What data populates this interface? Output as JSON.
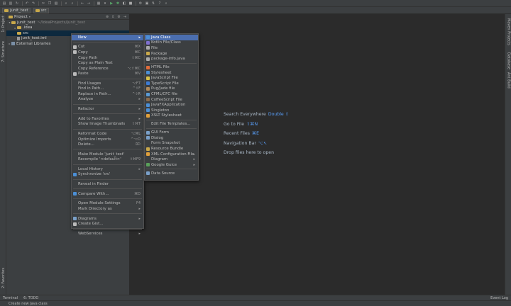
{
  "breadcrumb": [
    "junit_test",
    "src"
  ],
  "project_panel": {
    "title": "Project",
    "icons": [
      "⊕",
      "⇕",
      "⚙",
      "⇥"
    ],
    "tree": [
      {
        "label": "junit_test",
        "path": "~/IdeaProjects/junit_test",
        "depth": 0,
        "arrow": "▾",
        "icon": "folder"
      },
      {
        "label": ".idea",
        "path": "",
        "depth": 1,
        "arrow": "▸",
        "icon": "folder"
      },
      {
        "label": "src",
        "path": "",
        "depth": 1,
        "arrow": "",
        "icon": "folder",
        "selected": true
      },
      {
        "label": "junit_test.iml",
        "path": "",
        "depth": 1,
        "arrow": "",
        "icon": "file"
      },
      {
        "label": "External Libraries",
        "path": "",
        "depth": 0,
        "arrow": "▸",
        "icon": "lib"
      }
    ]
  },
  "left_tabs": [
    "1: Project",
    "7: Structure",
    "2: Favorites"
  ],
  "right_tabs": [
    "Maven Projects",
    "Database",
    "Ant Build"
  ],
  "editor_hints": [
    {
      "text": "Search Everywhere",
      "shortcut": "Double ⇧"
    },
    {
      "text": "Go to File",
      "shortcut": "⇧⌘N"
    },
    {
      "text": "Recent Files",
      "shortcut": "⌘E"
    },
    {
      "text": "Navigation Bar",
      "shortcut": "⌥↖"
    },
    {
      "text": "Drop files here to open",
      "shortcut": ""
    }
  ],
  "context_menu": [
    {
      "label": "New",
      "shortcut": "",
      "submenu": true,
      "highlight": true
    },
    {
      "sep": true
    },
    {
      "label": "Cut",
      "shortcut": "⌘X",
      "icon": "cut"
    },
    {
      "label": "Copy",
      "shortcut": "⌘C",
      "icon": "copy"
    },
    {
      "label": "Copy Path",
      "shortcut": "⇧⌘C"
    },
    {
      "label": "Copy as Plain Text",
      "shortcut": ""
    },
    {
      "label": "Copy Reference",
      "shortcut": "⌥⇧⌘C"
    },
    {
      "label": "Paste",
      "shortcut": "⌘V",
      "icon": "paste"
    },
    {
      "sep": true
    },
    {
      "label": "Find Usages",
      "shortcut": "⌥F7"
    },
    {
      "label": "Find in Path...",
      "shortcut": "^⇧F"
    },
    {
      "label": "Replace in Path...",
      "shortcut": "^⇧R"
    },
    {
      "label": "Analyze",
      "shortcut": "",
      "submenu": true
    },
    {
      "sep": true
    },
    {
      "label": "Refactor",
      "shortcut": "",
      "submenu": true
    },
    {
      "sep": true
    },
    {
      "label": "Add to Favorites",
      "shortcut": "",
      "submenu": true
    },
    {
      "label": "Show Image Thumbnails",
      "shortcut": "⇧⌘T"
    },
    {
      "sep": true
    },
    {
      "label": "Reformat Code",
      "shortcut": "⌥⌘L"
    },
    {
      "label": "Optimize Imports",
      "shortcut": "^⌥O"
    },
    {
      "label": "Delete...",
      "shortcut": "⌦"
    },
    {
      "sep": true
    },
    {
      "label": "Make Module 'junit_test'",
      "shortcut": ""
    },
    {
      "label": "Recompile '<default>'",
      "shortcut": "⇧⌘F9"
    },
    {
      "sep": true
    },
    {
      "label": "Local History",
      "shortcut": "",
      "submenu": true
    },
    {
      "label": "Synchronize 'src'",
      "shortcut": "",
      "icon": "sync"
    },
    {
      "sep": true
    },
    {
      "label": "Reveal in Finder",
      "shortcut": ""
    },
    {
      "sep": true
    },
    {
      "label": "Compare With...",
      "shortcut": "⌘D",
      "icon": "compare"
    },
    {
      "sep": true
    },
    {
      "label": "Open Module Settings",
      "shortcut": "F4"
    },
    {
      "label": "Mark Directory as",
      "shortcut": "",
      "submenu": true
    },
    {
      "sep": true
    },
    {
      "label": "Diagrams",
      "shortcut": "",
      "submenu": true,
      "icon": "diagram"
    },
    {
      "label": "Create Gist...",
      "shortcut": "",
      "icon": "gist"
    },
    {
      "sep": true
    },
    {
      "label": "WebServices",
      "shortcut": "",
      "submenu": true
    }
  ],
  "new_submenu": [
    {
      "label": "Java Class",
      "highlight": true,
      "icon_color": "#4b8fd6"
    },
    {
      "label": "Kotlin File/Class",
      "icon_color": "#7f6fd0"
    },
    {
      "label": "File",
      "icon_color": "#aaaaaa"
    },
    {
      "label": "Package",
      "icon_color": "#c9a84a"
    },
    {
      "label": "package-info.java",
      "icon_color": "#aaaaaa"
    },
    {
      "sep": true
    },
    {
      "label": "HTML File",
      "icon_color": "#e06c3b"
    },
    {
      "label": "Stylesheet",
      "icon_color": "#4b8fd6"
    },
    {
      "label": "JavaScript File",
      "icon_color": "#d8c24a"
    },
    {
      "label": "TypeScript File",
      "icon_color": "#3b7bd6"
    },
    {
      "label": "Pug/Jade file",
      "icon_color": "#b08a5a"
    },
    {
      "label": "CFML/CFC file",
      "icon_color": "#5a9bd6"
    },
    {
      "label": "CoffeeScript File",
      "icon_color": "#8a6a4a"
    },
    {
      "label": "JavaFXApplication",
      "icon_color": "#4b8fd6"
    },
    {
      "label": "Singleton",
      "icon_color": "#4b8fd6"
    },
    {
      "label": "XSLT Stylesheet",
      "icon_color": "#e0a03b"
    },
    {
      "sep": true
    },
    {
      "label": "Edit File Templates...",
      "icon_color": ""
    },
    {
      "sep": true
    },
    {
      "label": "GUI Form",
      "icon_color": "#7aa0c9"
    },
    {
      "label": "Dialog",
      "icon_color": "#7aa0c9"
    },
    {
      "label": "Form Snapshot",
      "icon_color": ""
    },
    {
      "label": "Resource Bundle",
      "icon_color": "#c9a84a"
    },
    {
      "label": "XML Configuration File",
      "icon_color": "#e0a03b",
      "submenu": true
    },
    {
      "label": "Diagram",
      "icon_color": "",
      "submenu": true
    },
    {
      "label": "Google Guice",
      "icon_color": "#5aa05a",
      "submenu": true
    },
    {
      "sep": true
    },
    {
      "label": "Data Source",
      "icon_color": "#7aa0c9"
    }
  ],
  "toolwin_bar": {
    "terminal": "Terminal",
    "todo": "6: TODO",
    "event_log": "Event Log"
  },
  "status_bar": {
    "text": "Create new Java class"
  }
}
